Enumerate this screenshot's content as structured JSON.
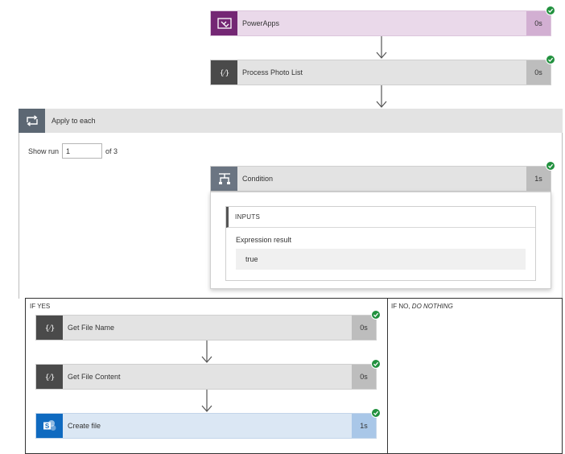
{
  "flow": {
    "powerapps": {
      "title": "PowerApps",
      "duration": "0s",
      "icon": "powerapps-icon",
      "status": "succeeded"
    },
    "process_photo_list": {
      "title": "Process Photo List",
      "duration": "0s",
      "icon": "compose-icon",
      "status": "succeeded"
    },
    "apply_to_each": {
      "title": "Apply to each",
      "icon": "loop-icon",
      "show_run_label": "Show run",
      "run_value": "1",
      "of_label": "of 3"
    },
    "condition": {
      "title": "Condition",
      "duration": "1s",
      "icon": "condition-icon",
      "status": "succeeded",
      "inputs_header": "INPUTS",
      "expression_label": "Expression result",
      "expression_value": "true"
    },
    "if_yes": {
      "label": "IF YES",
      "actions": [
        {
          "title": "Get File Name",
          "duration": "0s",
          "icon": "compose-icon",
          "status": "succeeded"
        },
        {
          "title": "Get File Content",
          "duration": "0s",
          "icon": "compose-icon",
          "status": "succeeded"
        },
        {
          "title": "Create file",
          "duration": "1s",
          "icon": "sharepoint-icon",
          "status": "succeeded"
        }
      ]
    },
    "if_no": {
      "label_prefix": "IF NO,",
      "label_suffix": "DO NOTHING"
    }
  },
  "colors": {
    "success": "#22913f",
    "powerapps": "#742774",
    "sharepoint": "#0f6ac0",
    "compose": "#4a4a4a",
    "condition": "#6b7582",
    "card_gray": "#e3e3e3"
  }
}
